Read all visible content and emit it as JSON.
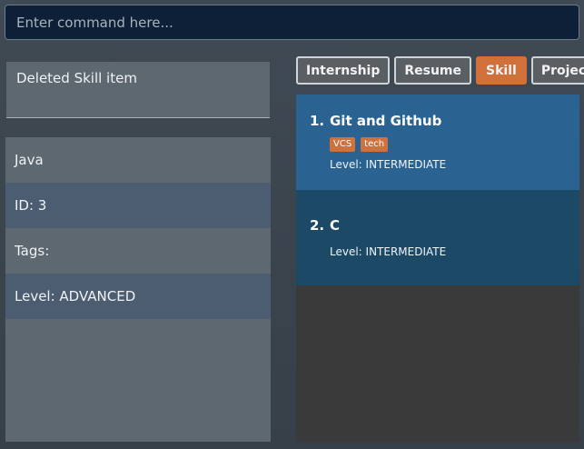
{
  "command": {
    "placeholder": "Enter command here..."
  },
  "result": {
    "text": "Deleted Skill item"
  },
  "detail": {
    "name": "Java",
    "id": "ID: 3",
    "tags": "Tags:",
    "level": "Level: ADVANCED"
  },
  "tabs": [
    {
      "label": "Internship",
      "active": false
    },
    {
      "label": "Resume",
      "active": false
    },
    {
      "label": "Skill",
      "active": true
    },
    {
      "label": "Project",
      "active": false
    }
  ],
  "list": [
    {
      "index": "1.",
      "title": "Git and Github",
      "tags": [
        "VCS",
        "tech"
      ],
      "level": "Level: INTERMEDIATE"
    },
    {
      "index": "2.",
      "title": "C",
      "tags": [],
      "level": "Level: INTERMEDIATE"
    }
  ],
  "colors": {
    "accent": "#d0703a",
    "selected_card": "#2a6392",
    "card": "#1c4966",
    "command_bg": "#0e2038"
  }
}
